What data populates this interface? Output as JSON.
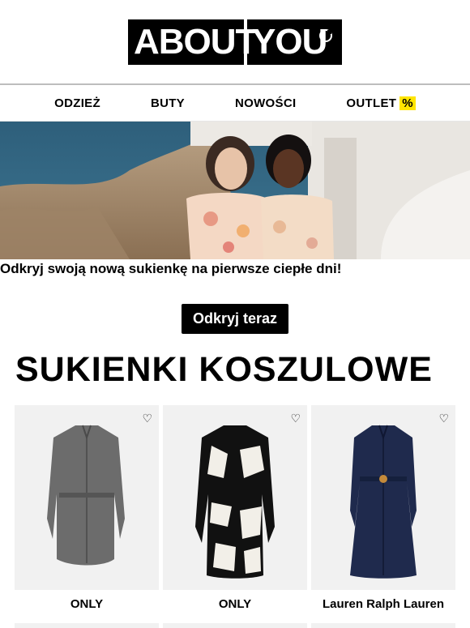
{
  "brand": {
    "logo_left": "ABOUT",
    "logo_right": "YOU"
  },
  "nav": {
    "items": [
      {
        "label": "ODZIEŻ"
      },
      {
        "label": "BUTY"
      },
      {
        "label": "NOWOŚCI"
      },
      {
        "label": "OUTLET",
        "badge": "%"
      }
    ]
  },
  "hero": {
    "tagline": "Odkryj swoją nową sukienkę na pierwsze ciepłe dni!"
  },
  "cta": {
    "label": "Odkryj teraz"
  },
  "section": {
    "title": "SUKIENKI KOSZULOWE"
  },
  "products": [
    {
      "brand": "ONLY",
      "icon": "heart-icon"
    },
    {
      "brand": "ONLY",
      "icon": "heart-icon"
    },
    {
      "brand": "Lauren Ralph Lauren",
      "icon": "heart-icon"
    }
  ],
  "colors": {
    "accent": "#ffe500",
    "primary": "#000000",
    "card_bg": "#f1f1f1"
  }
}
